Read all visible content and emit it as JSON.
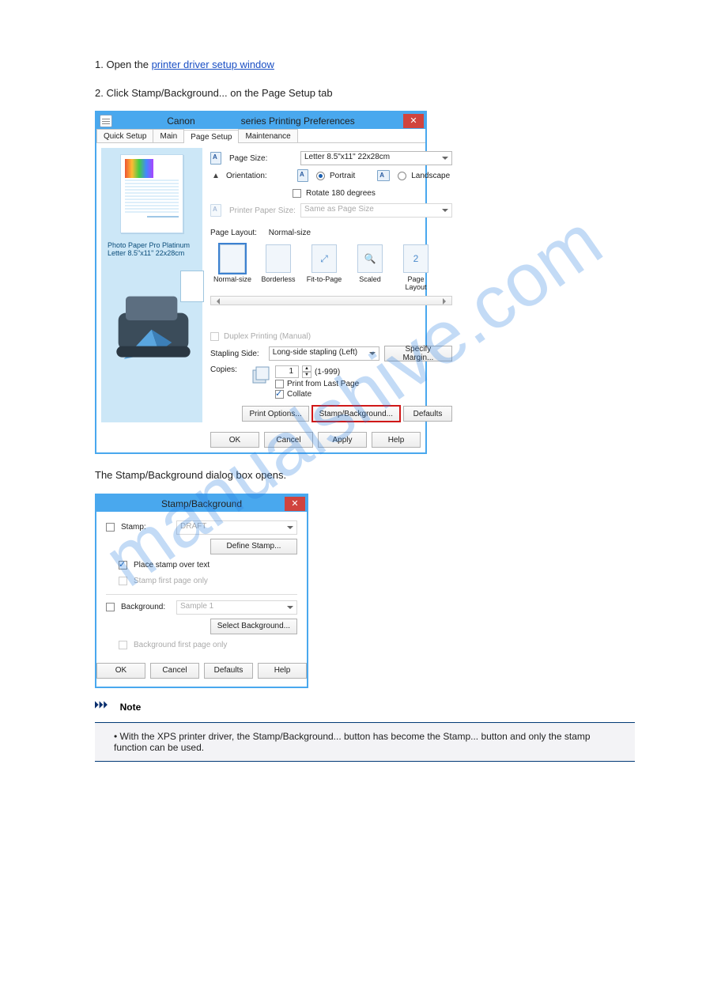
{
  "watermark": "manualshive.com",
  "doc": {
    "p1_pre": "1. Open the ",
    "p1_link": "printer driver setup window",
    "p2": "2. Click Stamp/Background... on the Page Setup tab",
    "p3": "The Stamp/Background dialog box opens.",
    "note_label": "Note",
    "note_text": "With the XPS printer driver, the Stamp/Background... button has become the Stamp... button and only the stamp function can be used."
  },
  "dialog1": {
    "title_prefix": "Canon ",
    "title_suffix": " series Printing Preferences",
    "tabs": [
      "Quick Setup",
      "Main",
      "Page Setup",
      "Maintenance"
    ],
    "page_size_label": "Page Size:",
    "page_size_value": "Letter 8.5\"x11\" 22x28cm",
    "orient_label": "Orientation:",
    "portrait": "Portrait",
    "landscape": "Landscape",
    "rotate180": "Rotate 180 degrees",
    "printer_paper_label": "Printer Paper Size:",
    "printer_paper_value": "Same as Page Size",
    "page_layout_label": "Page Layout:",
    "page_layout_value": "Normal-size",
    "layout_items": [
      "Normal-size",
      "Borderless",
      "Fit-to-Page",
      "Scaled",
      "Page Layout"
    ],
    "preview_caption1": "Photo Paper Pro Platinum",
    "preview_caption2": "Letter 8.5\"x11\" 22x28cm",
    "duplex": "Duplex Printing (Manual)",
    "stapling_label": "Stapling Side:",
    "stapling_value": "Long-side stapling (Left)",
    "margin_btn": "Specify Margin...",
    "copies_label": "Copies:",
    "copies_value": "1",
    "copies_range": "(1-999)",
    "print_last": "Print from Last Page",
    "collate": "Collate",
    "print_options_btn": "Print Options...",
    "stamp_btn": "Stamp/Background...",
    "defaults_btn": "Defaults",
    "ok": "OK",
    "cancel": "Cancel",
    "apply": "Apply",
    "help": "Help"
  },
  "dialog2": {
    "title": "Stamp/Background",
    "stamp_label": "Stamp:",
    "stamp_value": "DRAFT",
    "define_stamp": "Define Stamp...",
    "place_over": "Place stamp over text",
    "stamp_first": "Stamp first page only",
    "bg_label": "Background:",
    "bg_value": "Sample 1",
    "select_bg": "Select Background...",
    "bg_first": "Background first page only",
    "ok": "OK",
    "cancel": "Cancel",
    "defaults": "Defaults",
    "help": "Help"
  }
}
